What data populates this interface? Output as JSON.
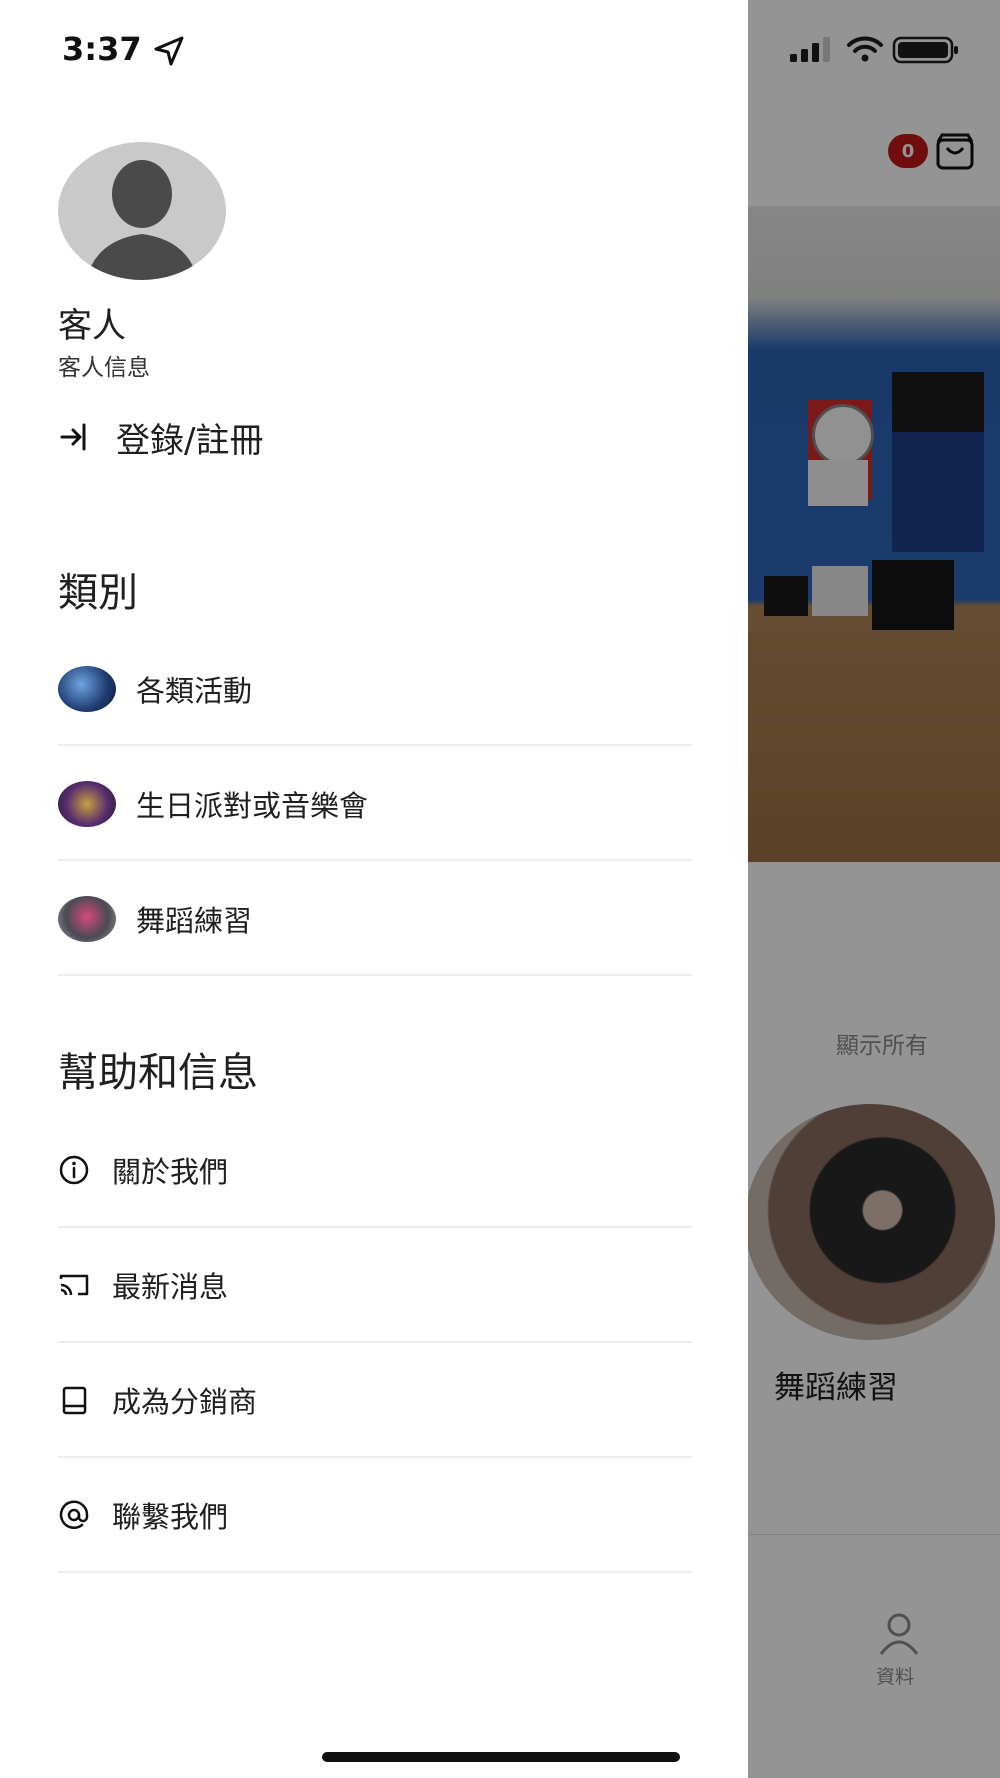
{
  "status_bar": {
    "time": "3:37"
  },
  "drawer": {
    "user": {
      "name": "客人",
      "subtitle": "客人信息"
    },
    "login_label": "登錄/註冊",
    "categories_title": "類別",
    "categories": [
      {
        "label": "各類活動",
        "thumb_color": "#2a4d8c"
      },
      {
        "label": "生日派對或音樂會",
        "thumb_color": "#4a3a2a"
      },
      {
        "label": "舞蹈練習",
        "thumb_color": "#7a6a6e"
      }
    ],
    "help_title": "幫助和信息",
    "help_items": [
      {
        "label": "關於我們",
        "icon": "info-icon"
      },
      {
        "label": "最新消息",
        "icon": "cast-icon"
      },
      {
        "label": "成為分銷商",
        "icon": "book-icon"
      },
      {
        "label": "聯繫我們",
        "icon": "at-icon"
      }
    ]
  },
  "background": {
    "cart_count": "0",
    "show_all": "顯示所有",
    "featured_label": "舞蹈練習",
    "tab_profile": "資料"
  }
}
